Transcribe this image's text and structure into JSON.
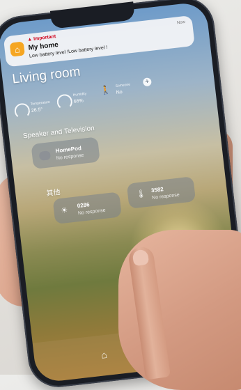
{
  "notification": {
    "important": "Important",
    "title": "My home",
    "body": "Low battery level !Low battery level !",
    "time": "Now",
    "app_icon": "home-icon"
  },
  "room": {
    "title": "Living room",
    "add": "+"
  },
  "stats": [
    {
      "label": "Temperature",
      "value": "26.5°"
    },
    {
      "label": "Humidity",
      "value": "66%"
    },
    {
      "label": "Someone",
      "value": "No"
    }
  ],
  "sections": {
    "speaker_tv": "Speaker and Television",
    "other": "其他"
  },
  "devices": {
    "homepod": {
      "name": "HomePod",
      "status": "No response"
    },
    "light": {
      "name": "0286",
      "status": "No response"
    },
    "thermo": {
      "name": "3582",
      "status": "No response"
    }
  },
  "tabbar": {
    "home_icon": "home-icon",
    "favorites_icon": "star-icon"
  },
  "colors": {
    "notification_important": "#d0021b",
    "home_app_icon": "#f5a623"
  }
}
